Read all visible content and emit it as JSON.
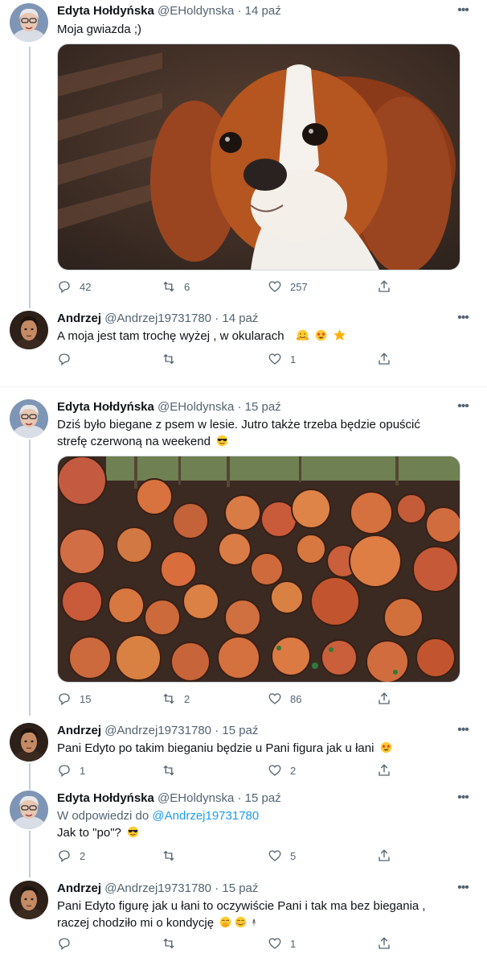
{
  "tweets": [
    {
      "name": "Edyta Hołdyńska",
      "handle": "@EHoldynska",
      "date": "14 paź",
      "text": "Moja gwiazda ;)",
      "reply": "42",
      "retweet": "6",
      "like": "257",
      "media": "dog-photo"
    },
    {
      "name": "Andrzej",
      "handle": "@Andrzej19731780",
      "date": "14 paź",
      "text": "A moja jest tam trochę wyżej , w okularach",
      "emojis": [
        "hugging-face-emoji",
        "star-struck-emoji",
        "star-emoji"
      ],
      "reply": "",
      "retweet": "",
      "like": "1"
    },
    {
      "name": "Edyta Hołdyńska",
      "handle": "@EHoldynska",
      "date": "15 paź",
      "text": "Dziś było biegane z psem w lesie. Jutro także trzeba będzie opuścić strefę czerwoną na weekend",
      "emojis": [
        "sunglasses-face-emoji"
      ],
      "reply": "15",
      "retweet": "2",
      "like": "86",
      "media": "logs-photo"
    },
    {
      "name": "Andrzej",
      "handle": "@Andrzej19731780",
      "date": "15 paź",
      "text": "Pani Edyto po takim bieganiu będzie  u Pani figura jak u łani",
      "emojis": [
        "star-struck-emoji"
      ],
      "reply": "1",
      "retweet": "",
      "like": "2"
    },
    {
      "name": "Edyta Hołdyńska",
      "handle": "@EHoldynska",
      "date": "15 paź",
      "reply_prefix": "W odpowiedzi do",
      "reply_to": "@Andrzej19731780",
      "text": "Jak to \"po\"?",
      "emojis": [
        "sunglasses-face-emoji"
      ],
      "reply": "2",
      "retweet": "",
      "like": "5"
    },
    {
      "name": "Andrzej",
      "handle": "@Andrzej19731780",
      "date": "15 paź",
      "text": "Pani  Edyto figurę jak u łani to oczywiście  Pani i tak ma bez biegania  , raczej chodziło mi o kondycję",
      "emojis": [
        "hand-over-mouth-emoji",
        "smiling-face-emoji",
        "microphone-emoji"
      ],
      "reply": "",
      "retweet": "",
      "like": "1"
    }
  ],
  "dot": "·",
  "more_label": "•••"
}
